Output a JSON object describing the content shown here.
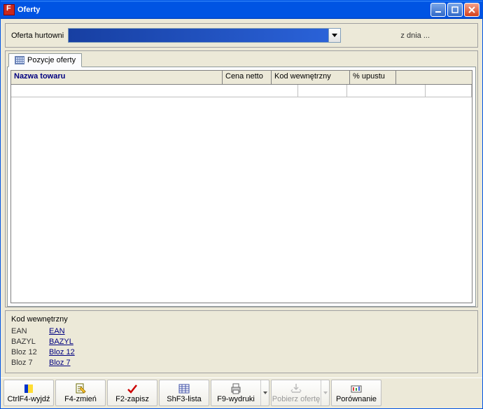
{
  "window": {
    "title": "Oferty"
  },
  "top": {
    "offer_label": "Oferta hurtowni",
    "date_label": "z dnia  ..."
  },
  "tabs": {
    "positions": "Pozycje oferty"
  },
  "grid": {
    "headers": {
      "name": "Nazwa towaru",
      "price": "Cena netto",
      "code": "Kod wewnętrzny",
      "discount": "% upustu"
    }
  },
  "info": {
    "title": "Kod wewnętrzny",
    "items": [
      {
        "key": "EAN",
        "value": "EAN"
      },
      {
        "key": "BAZYL",
        "value": "BAZYL"
      },
      {
        "key": "Bloz 12",
        "value": "Bloz 12"
      },
      {
        "key": "Bloz 7",
        "value": "Bloz 7"
      }
    ]
  },
  "toolbar": {
    "exit": "CtrlF4-wyjdź",
    "change": "F4-zmień",
    "save": "F2-zapisz",
    "list": "ShF3-lista",
    "print": "F9-wydruki",
    "download": "Pobierz ofertę",
    "compare": "Porównanie"
  }
}
